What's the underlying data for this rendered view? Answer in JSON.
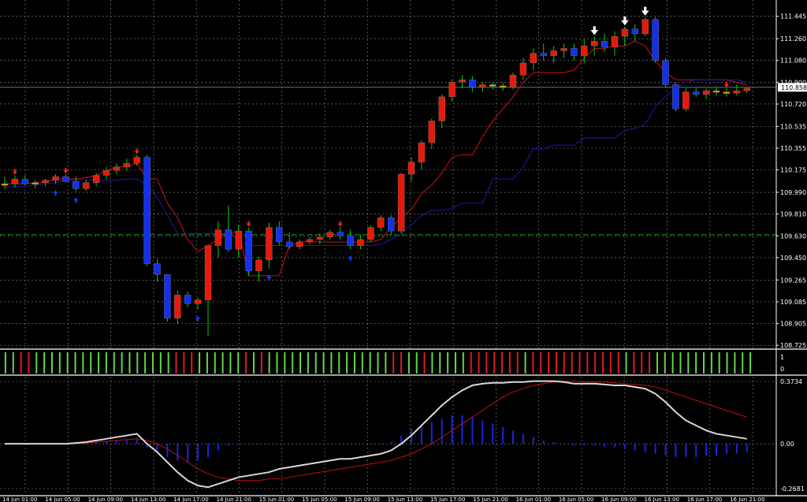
{
  "colors": {
    "background": "#000000",
    "grid": "#8a8a8a",
    "bull_candle": "#e8190b",
    "bear_candle": "#1330f0",
    "doji_candle": "#e8a000",
    "wick": "#00d000",
    "upper_band": "#cc1010",
    "lower_band": "#1a1aa8",
    "pivot_line": "#1a9a1a",
    "price_line": "#5a7a7a",
    "arrow_up": "#1a3aff",
    "arrow_down": "#ff2020",
    "signal_arrow": "#ffffff",
    "strip_green": "#66d44a",
    "strip_red": "#dc1c1c",
    "osc_main": "#d8d8d8",
    "osc_signal": "#c01010",
    "osc_hist": "#1a24e0",
    "text": "#ffffff",
    "price_box": "#ffffff"
  },
  "main_panel": {
    "price_axis": [
      "111.445",
      "111.260",
      "111.080",
      "110.900",
      "110.720",
      "110.535",
      "110.355",
      "110.175",
      "109.990",
      "109.810",
      "109.630",
      "109.450",
      "109.265",
      "109.085",
      "108.905",
      "108.725"
    ],
    "current_price": "110.858",
    "pivot_price": 109.64
  },
  "strip_panel": {
    "axis": [
      "1",
      "0"
    ],
    "colors": "GGRRGGGGGGGGGGGGGGGGGGRRRGGGGGGRGRGGGGGGGGGGGGGGGGRRGGRGGGGGRRRRRRRGRRRRRRRRRRRRGRRRGGGGGGGGGGGGG"
  },
  "osc_panel": {
    "axis": [
      "0.3734",
      "0.00",
      "-0.2681"
    ]
  },
  "time_axis": [
    "14 Jun 01:00",
    "14 Jun 05:00",
    "14 Jun 09:00",
    "14 Jun 13:00",
    "14 Jun 17:00",
    "14 Jun 21:00",
    "15 Jun 01:00",
    "15 Jun 05:00",
    "15 Jun 09:00",
    "15 Jun 13:00",
    "15 Jun 17:00",
    "15 Jun 21:00",
    "16 Jun 01:00",
    "16 Jun 05:00",
    "16 Jun 09:00",
    "16 Jun 13:00",
    "16 Jun 17:00",
    "16 Jun 21:00"
  ],
  "chart_data": [
    {
      "type": "candlestick",
      "title": "",
      "ylim": [
        108.7,
        111.58
      ],
      "candles_ohlc": [
        [
          110.05,
          110.12,
          110.02,
          110.06
        ],
        [
          110.06,
          110.13,
          110.03,
          110.1
        ],
        [
          110.1,
          110.13,
          110.05,
          110.06
        ],
        [
          110.06,
          110.09,
          110.02,
          110.07
        ],
        [
          110.07,
          110.1,
          110.04,
          110.09
        ],
        [
          110.09,
          110.14,
          110.06,
          110.12
        ],
        [
          110.12,
          110.14,
          110.07,
          110.08
        ],
        [
          110.08,
          110.12,
          110.0,
          110.02
        ],
        [
          110.02,
          110.09,
          110.0,
          110.07
        ],
        [
          110.07,
          110.15,
          110.04,
          110.13
        ],
        [
          110.13,
          110.2,
          110.1,
          110.17
        ],
        [
          110.17,
          110.23,
          110.14,
          110.2
        ],
        [
          110.2,
          110.27,
          110.17,
          110.23
        ],
        [
          110.23,
          110.3,
          110.21,
          110.28
        ],
        [
          110.28,
          110.3,
          109.38,
          109.4
        ],
        [
          109.4,
          109.44,
          109.25,
          109.31
        ],
        [
          109.31,
          109.31,
          108.92,
          108.95
        ],
        [
          108.95,
          109.18,
          108.9,
          109.14
        ],
        [
          109.14,
          109.17,
          109.04,
          109.07
        ],
        [
          109.07,
          109.12,
          109.02,
          109.1
        ],
        [
          109.1,
          109.55,
          108.8,
          109.55
        ],
        [
          109.55,
          109.75,
          109.45,
          109.68
        ],
        [
          109.68,
          109.88,
          109.5,
          109.52
        ],
        [
          109.52,
          109.72,
          109.45,
          109.67
        ],
        [
          109.67,
          109.7,
          109.3,
          109.34
        ],
        [
          109.34,
          109.46,
          109.25,
          109.43
        ],
        [
          109.43,
          109.74,
          109.36,
          109.7
        ],
        [
          109.7,
          109.75,
          109.55,
          109.58
        ],
        [
          109.58,
          109.66,
          109.52,
          109.54
        ],
        [
          109.54,
          109.6,
          109.52,
          109.58
        ],
        [
          109.58,
          109.62,
          109.56,
          109.6
        ],
        [
          109.6,
          109.65,
          109.56,
          109.62
        ],
        [
          109.62,
          109.68,
          109.6,
          109.66
        ],
        [
          109.66,
          109.7,
          109.6,
          109.63
        ],
        [
          109.63,
          109.68,
          109.52,
          109.55
        ],
        [
          109.55,
          109.64,
          109.52,
          109.6
        ],
        [
          109.6,
          109.72,
          109.58,
          109.7
        ],
        [
          109.7,
          109.8,
          109.67,
          109.78
        ],
        [
          109.78,
          109.8,
          109.64,
          109.67
        ],
        [
          109.67,
          110.15,
          109.65,
          110.14
        ],
        [
          110.14,
          110.28,
          110.08,
          110.24
        ],
        [
          110.24,
          110.42,
          110.18,
          110.4
        ],
        [
          110.4,
          110.6,
          110.35,
          110.58
        ],
        [
          110.58,
          110.8,
          110.52,
          110.78
        ],
        [
          110.78,
          110.92,
          110.74,
          110.9
        ],
        [
          110.9,
          110.96,
          110.85,
          110.92
        ],
        [
          110.92,
          110.95,
          110.82,
          110.86
        ],
        [
          110.86,
          110.9,
          110.82,
          110.88
        ],
        [
          110.88,
          110.9,
          110.84,
          110.87
        ],
        [
          110.87,
          110.9,
          110.83,
          110.86
        ],
        [
          110.86,
          110.98,
          110.84,
          110.96
        ],
        [
          110.96,
          111.1,
          110.92,
          111.06
        ],
        [
          111.06,
          111.18,
          111.0,
          111.14
        ],
        [
          111.14,
          111.22,
          111.08,
          111.12
        ],
        [
          111.12,
          111.2,
          111.06,
          111.16
        ],
        [
          111.16,
          111.22,
          111.1,
          111.18
        ],
        [
          111.18,
          111.22,
          111.08,
          111.12
        ],
        [
          111.12,
          111.26,
          111.06,
          111.2
        ],
        [
          111.2,
          111.28,
          111.12,
          111.24
        ],
        [
          111.24,
          111.3,
          111.15,
          111.19
        ],
        [
          111.19,
          111.32,
          111.12,
          111.28
        ],
        [
          111.28,
          111.36,
          111.2,
          111.34
        ],
        [
          111.34,
          111.38,
          111.24,
          111.3
        ],
        [
          111.3,
          111.44,
          111.28,
          111.42
        ],
        [
          111.42,
          111.44,
          111.06,
          111.08
        ],
        [
          111.08,
          111.1,
          110.86,
          110.88
        ],
        [
          110.88,
          110.9,
          110.66,
          110.68
        ],
        [
          110.68,
          110.85,
          110.66,
          110.82
        ],
        [
          110.82,
          110.86,
          110.78,
          110.8
        ],
        [
          110.8,
          110.85,
          110.76,
          110.83
        ],
        [
          110.83,
          110.86,
          110.79,
          110.82
        ],
        [
          110.82,
          110.85,
          110.78,
          110.81
        ],
        [
          110.81,
          110.88,
          110.79,
          110.83
        ],
        [
          110.83,
          110.86,
          110.81,
          110.85
        ]
      ],
      "upper_band": [
        110.06,
        110.06,
        110.06,
        110.07,
        110.07,
        110.1,
        110.1,
        110.1,
        110.11,
        110.13,
        110.17,
        110.2,
        110.2,
        110.23,
        110.1,
        110.1,
        109.9,
        109.78,
        109.6,
        109.5,
        109.55,
        109.6,
        109.65,
        109.67,
        109.3,
        109.3,
        109.3,
        109.3,
        109.55,
        109.58,
        109.58,
        109.58,
        109.58,
        109.58,
        109.58,
        109.58,
        109.58,
        109.6,
        109.7,
        109.78,
        109.85,
        109.98,
        110.05,
        110.15,
        110.28,
        110.3,
        110.3,
        110.45,
        110.58,
        110.68,
        110.78,
        110.9,
        110.98,
        110.98,
        110.98,
        110.98,
        111.0,
        111.1,
        111.18,
        111.18,
        111.2,
        111.2,
        111.24,
        111.2,
        111.08,
        110.98,
        110.92,
        110.92,
        110.92,
        110.92,
        110.92,
        110.92,
        110.9,
        110.88
      ],
      "lower_band": [
        110.03,
        110.04,
        110.04,
        110.05,
        110.06,
        110.07,
        110.09,
        110.09,
        110.09,
        110.09,
        110.09,
        110.09,
        110.1,
        110.1,
        110.05,
        109.95,
        109.8,
        109.65,
        109.65,
        109.65,
        109.65,
        109.65,
        109.65,
        109.6,
        109.55,
        109.55,
        109.55,
        109.55,
        109.55,
        109.55,
        109.55,
        109.55,
        109.55,
        109.55,
        109.55,
        109.55,
        109.55,
        109.56,
        109.6,
        109.65,
        109.72,
        109.8,
        109.84,
        109.84,
        109.86,
        109.9,
        109.9,
        109.9,
        110.1,
        110.1,
        110.1,
        110.2,
        110.35,
        110.35,
        110.38,
        110.38,
        110.38,
        110.44,
        110.44,
        110.44,
        110.44,
        110.5,
        110.52,
        110.55,
        110.7,
        110.78,
        110.85,
        110.9,
        110.92,
        110.92,
        110.92,
        110.92,
        110.92,
        110.9
      ]
    },
    {
      "type": "bar",
      "title": "",
      "ylim": [
        0,
        1
      ]
    },
    {
      "type": "line",
      "title": "",
      "ylim": [
        -0.2681,
        0.3734
      ],
      "series": [
        {
          "values": [
            0.0,
            0.0,
            0.0,
            0.0,
            0.0,
            0.0,
            0.0,
            0.005,
            0.01,
            0.02,
            0.03,
            0.04,
            0.05,
            0.06,
            0.0,
            -0.05,
            -0.11,
            -0.17,
            -0.22,
            -0.25,
            -0.26,
            -0.24,
            -0.22,
            -0.2,
            -0.19,
            -0.18,
            -0.17,
            -0.15,
            -0.14,
            -0.13,
            -0.12,
            -0.11,
            -0.1,
            -0.09,
            -0.09,
            -0.08,
            -0.07,
            -0.06,
            -0.04,
            0.0,
            0.05,
            0.11,
            0.17,
            0.23,
            0.28,
            0.32,
            0.35,
            0.36,
            0.365,
            0.365,
            0.37,
            0.37,
            0.375,
            0.375,
            0.375,
            0.37,
            0.36,
            0.36,
            0.36,
            0.355,
            0.35,
            0.35,
            0.34,
            0.33,
            0.3,
            0.25,
            0.19,
            0.14,
            0.11,
            0.08,
            0.06,
            0.05,
            0.04,
            0.03
          ]
        },
        {
          "values": [
            0.0,
            0.0,
            0.0,
            0.0,
            0.0,
            0.0,
            0.0,
            0.0,
            0.005,
            0.01,
            0.015,
            0.02,
            0.025,
            0.03,
            0.02,
            0.0,
            -0.03,
            -0.07,
            -0.11,
            -0.15,
            -0.18,
            -0.2,
            -0.21,
            -0.22,
            -0.22,
            -0.22,
            -0.21,
            -0.21,
            -0.2,
            -0.19,
            -0.18,
            -0.17,
            -0.16,
            -0.15,
            -0.14,
            -0.13,
            -0.12,
            -0.11,
            -0.1,
            -0.08,
            -0.06,
            -0.03,
            0.0,
            0.04,
            0.08,
            0.12,
            0.16,
            0.2,
            0.24,
            0.28,
            0.31,
            0.33,
            0.35,
            0.36,
            0.37,
            0.375,
            0.375,
            0.37,
            0.37,
            0.37,
            0.365,
            0.36,
            0.355,
            0.35,
            0.34,
            0.32,
            0.3,
            0.28,
            0.26,
            0.24,
            0.22,
            0.2,
            0.18,
            0.16
          ]
        },
        {
          "values": [
            0.0,
            0.0,
            0.0,
            0.0,
            0.0,
            0.0,
            0.0,
            0.005,
            0.01,
            0.01,
            0.015,
            0.02,
            0.025,
            0.03,
            -0.02,
            -0.05,
            -0.08,
            -0.1,
            -0.11,
            -0.1,
            -0.08,
            -0.04,
            -0.01,
            0.0,
            0.0,
            0.0,
            0.0,
            0.0,
            0.0,
            0.0,
            0.0,
            0.0,
            0.0,
            0.0,
            0.0,
            0.0,
            0.0,
            0.0,
            0.01,
            0.05,
            0.09,
            0.11,
            0.13,
            0.15,
            0.17,
            0.17,
            0.16,
            0.14,
            0.12,
            0.1,
            0.08,
            0.06,
            0.04,
            0.02,
            0.01,
            0.0,
            -0.01,
            -0.01,
            -0.01,
            -0.02,
            -0.02,
            -0.03,
            -0.04,
            -0.05,
            -0.06,
            -0.07,
            -0.08,
            -0.08,
            -0.08,
            -0.07,
            -0.07,
            -0.06,
            -0.06,
            -0.05
          ]
        }
      ]
    }
  ]
}
